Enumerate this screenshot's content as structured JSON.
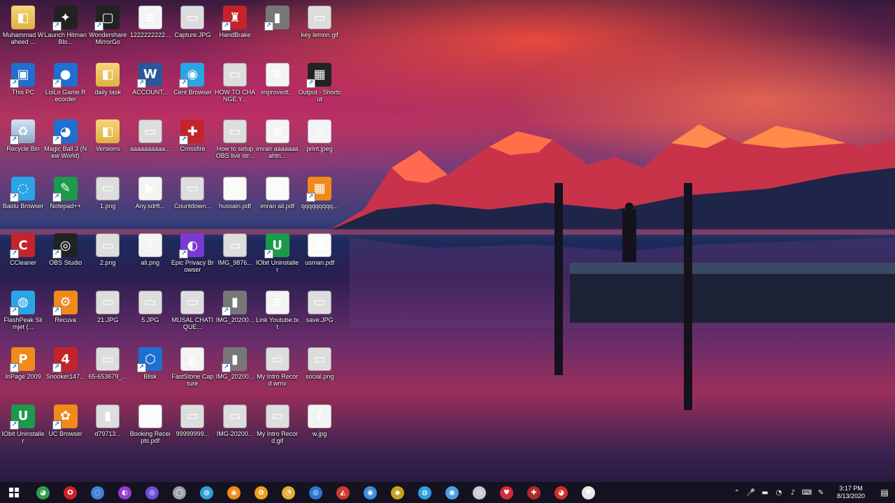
{
  "desktop": {
    "icons": [
      {
        "label": "Muhammad Waheed ...",
        "glyph": "◧",
        "style": "g-folder",
        "name": "user-folder-icon"
      },
      {
        "label": "Launch Hitman Blo...",
        "glyph": "✦",
        "style": "g-app-dark",
        "name": "hitman-launcher-icon"
      },
      {
        "label": "Wondershare MirrorGo",
        "glyph": "▢",
        "style": "g-app-dark",
        "name": "mirrorgo-icon"
      },
      {
        "label": "1222222222...",
        "glyph": "≡",
        "style": "g-doc",
        "name": "document-file-icon"
      },
      {
        "label": "Capture.JPG",
        "glyph": "▭",
        "style": "g-img",
        "name": "image-file-icon"
      },
      {
        "label": "HandBrake",
        "glyph": "♜",
        "style": "g-app-red",
        "name": "handbrake-icon"
      },
      {
        "label": "",
        "glyph": "▮",
        "style": "g-app-gray",
        "name": "file-icon"
      },
      {
        "label": "key lemon.gif",
        "glyph": "▭",
        "style": "g-img",
        "name": "gif-file-icon"
      },
      {
        "label": "This PC",
        "glyph": "▣",
        "style": "g-app-blue",
        "name": "this-pc-icon"
      },
      {
        "label": "LoiLo Game Recorder",
        "glyph": "●",
        "style": "g-app-blue",
        "name": "loilo-recorder-icon"
      },
      {
        "label": "daily task",
        "glyph": "◧",
        "style": "g-folder",
        "name": "folder-icon"
      },
      {
        "label": "ACCOUNT...",
        "glyph": "W",
        "style": "g-word",
        "name": "word-document-icon"
      },
      {
        "label": "Cent Browser",
        "glyph": "◉",
        "style": "g-app-cyan",
        "name": "cent-browser-icon"
      },
      {
        "label": "HOW TO CHANGE Y...",
        "glyph": "▭",
        "style": "g-img",
        "name": "image-file-icon"
      },
      {
        "label": "improvedt...",
        "glyph": "≡",
        "style": "g-doc",
        "name": "text-file-icon"
      },
      {
        "label": "Output - Shortcut",
        "glyph": "▦",
        "style": "g-app-dark",
        "name": "output-shortcut-icon"
      },
      {
        "label": "Recycle Bin",
        "glyph": "♻",
        "style": "g-bin",
        "name": "recycle-bin-icon"
      },
      {
        "label": "Magic Ball 3 (New World)",
        "glyph": "◕",
        "style": "g-app-blue",
        "name": "magic-ball-icon"
      },
      {
        "label": "Versions",
        "glyph": "◧",
        "style": "g-folder",
        "name": "folder-icon"
      },
      {
        "label": "aaaaaaaaaa...",
        "glyph": "▭",
        "style": "g-img",
        "name": "image-file-icon"
      },
      {
        "label": "Crossfire",
        "glyph": "✚",
        "style": "g-app-red",
        "name": "crossfire-icon"
      },
      {
        "label": "How to setup OBS live str...",
        "glyph": "▭",
        "style": "g-img",
        "name": "image-file-icon"
      },
      {
        "label": "imran aaaaaaaahtn...",
        "glyph": "≡",
        "style": "g-doc",
        "name": "document-file-icon"
      },
      {
        "label": "print.jpeg",
        "glyph": "▯",
        "style": "g-doc",
        "name": "jpeg-file-icon"
      },
      {
        "label": "Baidu Browser",
        "glyph": "◌",
        "style": "g-app-cyan",
        "name": "baidu-browser-icon"
      },
      {
        "label": "Notepad++",
        "glyph": "✎",
        "style": "g-app-green",
        "name": "notepad-plus-plus-icon"
      },
      {
        "label": "1.png",
        "glyph": "▭",
        "style": "g-img",
        "name": "png-file-icon"
      },
      {
        "label": "Any.sdrft...",
        "glyph": "▶",
        "style": "g-doc",
        "name": "file-icon"
      },
      {
        "label": "Countdown...",
        "glyph": "▭",
        "style": "g-img",
        "name": "image-file-icon"
      },
      {
        "label": "hussain.pdf",
        "glyph": "≡",
        "style": "g-pdf",
        "name": "pdf-file-icon"
      },
      {
        "label": "imran ali.pdf",
        "glyph": "≡",
        "style": "g-pdf",
        "name": "pdf-file-icon"
      },
      {
        "label": "qqqqqqqqq...",
        "glyph": "▦",
        "style": "g-app-orange",
        "name": "image-file-icon"
      },
      {
        "label": "CCleaner",
        "glyph": "C",
        "style": "g-app-red",
        "name": "ccleaner-icon"
      },
      {
        "label": "OBS Studio",
        "glyph": "◎",
        "style": "g-app-dark",
        "name": "obs-studio-icon"
      },
      {
        "label": "2.png",
        "glyph": "▭",
        "style": "g-img",
        "name": "png-file-icon"
      },
      {
        "label": "ali.png",
        "glyph": "▯",
        "style": "g-doc",
        "name": "png-file-icon"
      },
      {
        "label": "Epic Privacy Browser",
        "glyph": "◐",
        "style": "g-app-purple",
        "name": "epic-browser-icon"
      },
      {
        "label": "IMG_9876...",
        "glyph": "▭",
        "style": "g-img",
        "name": "image-file-icon"
      },
      {
        "label": "IObit Uninstaller",
        "glyph": "U",
        "style": "g-app-green",
        "name": "iobit-uninstaller-icon"
      },
      {
        "label": "usman.pdf",
        "glyph": "≡",
        "style": "g-pdf",
        "name": "pdf-file-icon"
      },
      {
        "label": "FlashPeak Slimjet (...",
        "glyph": "◍",
        "style": "g-app-cyan",
        "name": "slimjet-icon"
      },
      {
        "label": "Recuva",
        "glyph": "⚙",
        "style": "g-app-orange",
        "name": "recuva-icon"
      },
      {
        "label": "21.JPG",
        "glyph": "▭",
        "style": "g-img",
        "name": "jpg-file-icon"
      },
      {
        "label": "5.JPG",
        "glyph": "▭",
        "style": "g-img",
        "name": "jpg-file-icon"
      },
      {
        "label": "MUSAL CHATIQUE...",
        "glyph": "▭",
        "style": "g-img",
        "name": "image-file-icon"
      },
      {
        "label": "IMG_20200...",
        "glyph": "▮",
        "style": "g-app-gray",
        "name": "image-file-icon"
      },
      {
        "label": "Link Youtube.txt",
        "glyph": "≡",
        "style": "g-doc",
        "name": "text-file-icon"
      },
      {
        "label": "save.JPG",
        "glyph": "▭",
        "style": "g-img",
        "name": "jpg-file-icon"
      },
      {
        "label": "InPage 2009",
        "glyph": "P",
        "style": "g-app-orange",
        "name": "inpage-icon"
      },
      {
        "label": "Snooker147...",
        "glyph": "4",
        "style": "g-app-red",
        "name": "snooker-icon"
      },
      {
        "label": "65-653679_...",
        "glyph": "▭",
        "style": "g-img",
        "name": "image-file-icon"
      },
      {
        "label": "Blisk",
        "glyph": "⬡",
        "style": "g-app-blue",
        "name": "blisk-icon"
      },
      {
        "label": "FastStone Capture",
        "glyph": "◭",
        "style": "g-doc",
        "name": "faststone-capture-icon"
      },
      {
        "label": "IMG_20200...",
        "glyph": "▮",
        "style": "g-app-gray",
        "name": "image-file-icon"
      },
      {
        "label": "My Intro Record.wmv",
        "glyph": "▭",
        "style": "g-img",
        "name": "video-file-icon"
      },
      {
        "label": "social.png",
        "glyph": "▭",
        "style": "g-img",
        "name": "png-file-icon"
      },
      {
        "label": "IObit Uninstaller",
        "glyph": "U",
        "style": "g-app-green",
        "name": "iobit-uninstaller-icon"
      },
      {
        "label": "UC Browser",
        "glyph": "✿",
        "style": "g-app-orange",
        "name": "uc-browser-icon"
      },
      {
        "label": "d79713...",
        "glyph": "▮",
        "style": "g-img",
        "name": "image-file-icon"
      },
      {
        "label": "Booking Receipts.pdf",
        "glyph": "≡",
        "style": "g-pdf",
        "name": "pdf-file-icon"
      },
      {
        "label": "99999999...",
        "glyph": "▭",
        "style": "g-img",
        "name": "image-file-icon"
      },
      {
        "label": "IMG-20200...",
        "glyph": "▭",
        "style": "g-img",
        "name": "image-file-icon"
      },
      {
        "label": "My Intro Record.gif",
        "glyph": "▭",
        "style": "g-img",
        "name": "gif-file-icon"
      },
      {
        "label": "w.jpg",
        "glyph": "i",
        "style": "g-doc",
        "name": "jpg-file-icon"
      }
    ]
  },
  "taskbar": {
    "apps": [
      {
        "glyph": "◕",
        "color": "#2e9d4f",
        "name": "chrome-taskbar-icon"
      },
      {
        "glyph": "O",
        "color": "#d0202a",
        "name": "opera-taskbar-icon"
      },
      {
        "glyph": "◌",
        "color": "#3f82d8",
        "name": "browser-taskbar-icon"
      },
      {
        "glyph": "◐",
        "color": "#9a3ad0",
        "name": "epic-browser-taskbar-icon"
      },
      {
        "glyph": "◎",
        "color": "#6b4fd8",
        "name": "app-taskbar-icon"
      },
      {
        "glyph": "◯",
        "color": "#9aa0a8",
        "name": "app-taskbar-icon"
      },
      {
        "glyph": "◍",
        "color": "#2d9fd6",
        "name": "slimjet-taskbar-icon"
      },
      {
        "glyph": "◉",
        "color": "#f08a1a",
        "name": "firefox-taskbar-icon"
      },
      {
        "glyph": "✿",
        "color": "#f0a020",
        "name": "uc-browser-taskbar-icon"
      },
      {
        "glyph": "◔",
        "color": "#e0b030",
        "name": "app-taskbar-icon"
      },
      {
        "glyph": "◎",
        "color": "#2a76d0",
        "name": "app-taskbar-icon"
      },
      {
        "glyph": "◭",
        "color": "#d03a2a",
        "name": "app-taskbar-icon"
      },
      {
        "glyph": "◉",
        "color": "#3a8ee0",
        "name": "app-taskbar-icon"
      },
      {
        "glyph": "◆",
        "color": "#caa020",
        "name": "app-taskbar-icon"
      },
      {
        "glyph": "◍",
        "color": "#2a9fe0",
        "name": "app-taskbar-icon"
      },
      {
        "glyph": "◉",
        "color": "#4a9fe8",
        "name": "app-taskbar-icon"
      },
      {
        "glyph": "◇",
        "color": "#c8ccd2",
        "name": "app-taskbar-icon"
      },
      {
        "glyph": "♥",
        "color": "#d82a3a",
        "name": "app-taskbar-icon"
      },
      {
        "glyph": "✚",
        "color": "#b02a2a",
        "name": "crossfire-taskbar-icon"
      },
      {
        "glyph": "◕",
        "color": "#d0302a",
        "name": "app-taskbar-icon"
      },
      {
        "glyph": "♥",
        "color": "#e8e8e8",
        "name": "app-taskbar-icon"
      }
    ],
    "tray": {
      "icons": [
        {
          "glyph": "⌃",
          "name": "show-hidden-icons-icon"
        },
        {
          "glyph": "🎤",
          "name": "microphone-icon"
        },
        {
          "glyph": "▬",
          "name": "battery-icon"
        },
        {
          "glyph": "◔",
          "name": "network-icon"
        },
        {
          "glyph": "♪",
          "name": "volume-icon"
        },
        {
          "glyph": "⌨",
          "name": "keyboard-icon"
        },
        {
          "glyph": "✎",
          "name": "pen-icon"
        }
      ],
      "time": "3:17 PM",
      "date": "8/13/2020",
      "notification_glyph": "▤"
    }
  }
}
